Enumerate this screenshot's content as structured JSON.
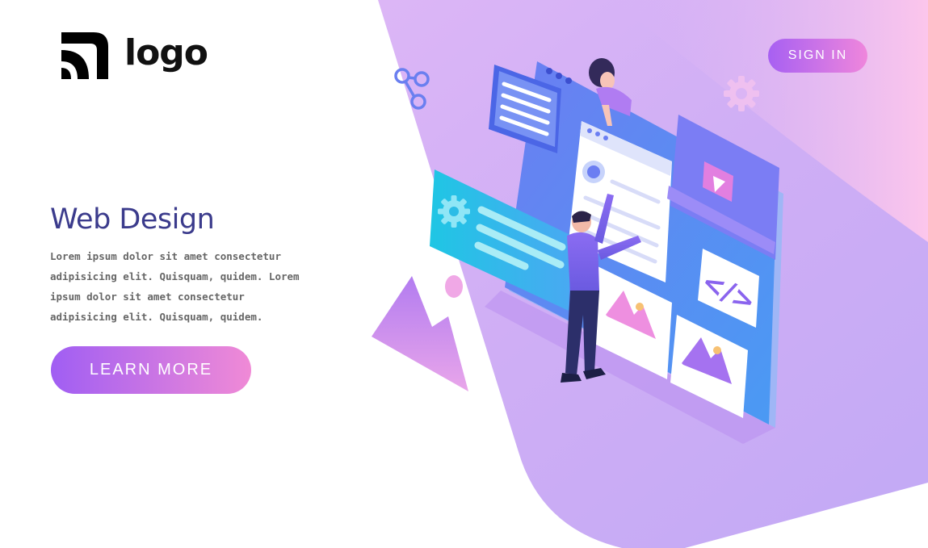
{
  "header": {
    "logo_text": "logo",
    "sign_in_label": "SIGN IN"
  },
  "hero": {
    "title": "Web Design",
    "body": "Lorem ipsum dolor sit amet consectetur adipisicing elit. Quisquam, quidem. Lorem ipsum dolor sit amet consectetur adipisicing elit. Quisquam, quidem.",
    "cta_label": "LEARN MORE"
  },
  "illustration": {
    "code_tag": "</>"
  },
  "colors": {
    "accent_start": "#a05ef3",
    "accent_end": "#f08ad6",
    "title": "#3b3b8c",
    "panel_blue": "#5b7cf0"
  }
}
